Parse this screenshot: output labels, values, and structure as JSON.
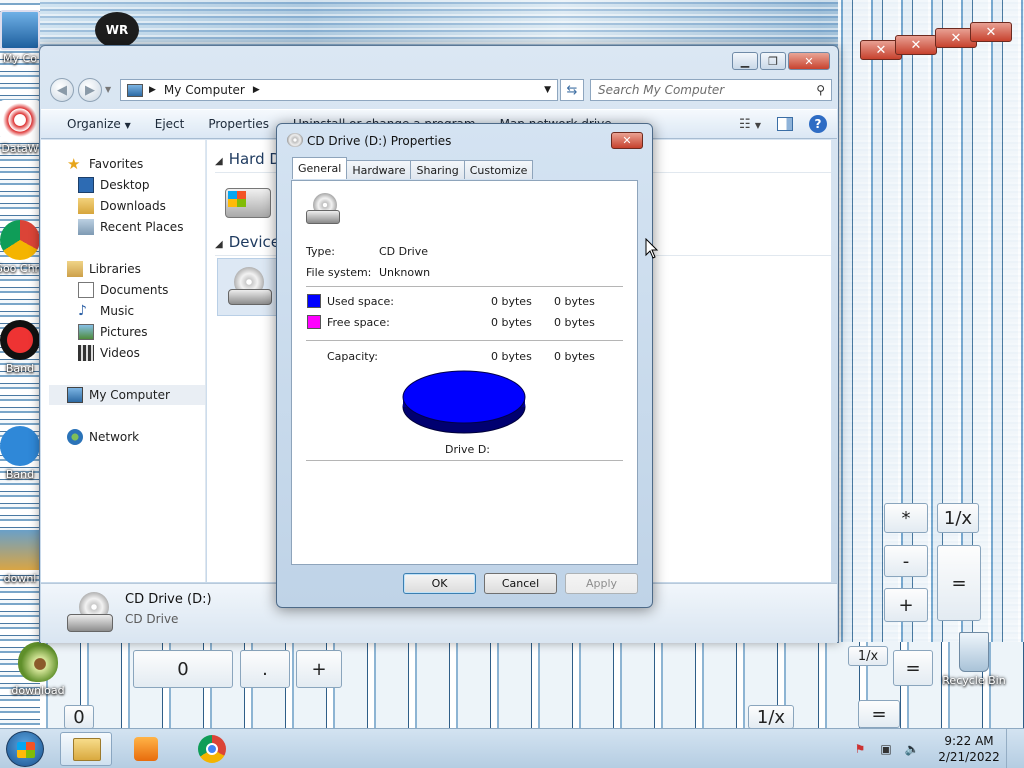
{
  "desktop": {
    "icons": [
      {
        "label": "My Co"
      },
      {
        "label": "DataW"
      },
      {
        "label": "Goo Chro"
      },
      {
        "label": "Band"
      },
      {
        "label": "Band"
      },
      {
        "label": "downl"
      },
      {
        "label": "download"
      },
      {
        "label": "Recycle Bin"
      }
    ],
    "wr_label": "WR",
    "calc_keys": [
      "0",
      ".",
      "+",
      "1/x",
      "*",
      "=",
      "-",
      "+",
      "=",
      "1/x",
      "=",
      "0",
      "1/x"
    ]
  },
  "explorer": {
    "address": {
      "crumb": "My Computer"
    },
    "search_placeholder": "Search My Computer",
    "toolbar": {
      "organize": "Organize",
      "eject": "Eject",
      "properties": "Properties",
      "uninstall": "Uninstall or change a program",
      "map_drive": "Map network drive"
    },
    "nav": {
      "favorites": "Favorites",
      "desktop": "Desktop",
      "downloads": "Downloads",
      "recent": "Recent Places",
      "libraries": "Libraries",
      "documents": "Documents",
      "music": "Music",
      "pictures": "Pictures",
      "videos": "Videos",
      "computer": "My Computer",
      "network": "Network"
    },
    "groups": {
      "hard": "Hard D",
      "devices": "Devices"
    },
    "details": {
      "name": "CD Drive (D:)",
      "type": "CD Drive"
    }
  },
  "dialog": {
    "title": "CD Drive (D:) Properties",
    "tabs": [
      "General",
      "Hardware",
      "Sharing",
      "Customize"
    ],
    "type_label": "Type:",
    "type_value": "CD Drive",
    "fs_label": "File system:",
    "fs_value": "Unknown",
    "used_label": "Used space:",
    "used_bytes": "0 bytes",
    "used_size": "0 bytes",
    "free_label": "Free space:",
    "free_bytes": "0 bytes",
    "free_size": "0 bytes",
    "capacity_label": "Capacity:",
    "capacity_bytes": "0 bytes",
    "capacity_size": "0 bytes",
    "drive_label": "Drive D:",
    "ok": "OK",
    "cancel": "Cancel",
    "apply": "Apply",
    "colors": {
      "used": "#0000ff",
      "free": "#ff00ff"
    }
  },
  "taskbar": {
    "time": "9:22 AM",
    "date": "2/21/2022"
  }
}
